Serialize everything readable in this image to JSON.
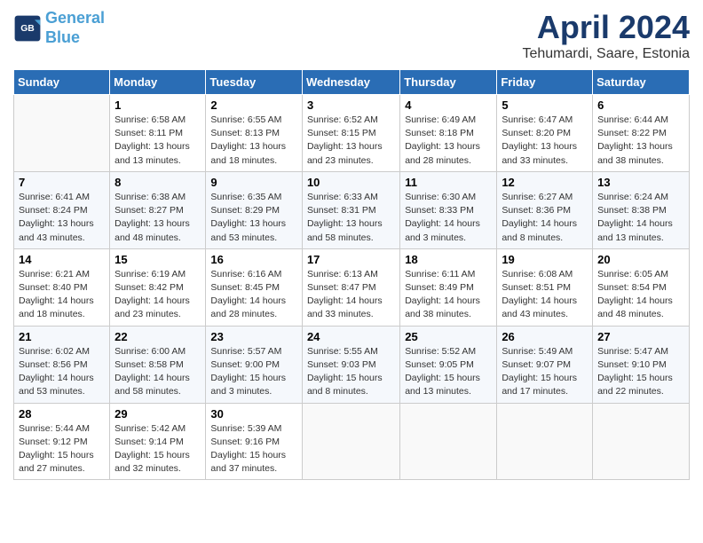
{
  "header": {
    "logo_line1": "General",
    "logo_line2": "Blue",
    "month_title": "April 2024",
    "location": "Tehumardi, Saare, Estonia"
  },
  "weekdays": [
    "Sunday",
    "Monday",
    "Tuesday",
    "Wednesday",
    "Thursday",
    "Friday",
    "Saturday"
  ],
  "weeks": [
    [
      {
        "day": "",
        "info": ""
      },
      {
        "day": "1",
        "info": "Sunrise: 6:58 AM\nSunset: 8:11 PM\nDaylight: 13 hours\nand 13 minutes."
      },
      {
        "day": "2",
        "info": "Sunrise: 6:55 AM\nSunset: 8:13 PM\nDaylight: 13 hours\nand 18 minutes."
      },
      {
        "day": "3",
        "info": "Sunrise: 6:52 AM\nSunset: 8:15 PM\nDaylight: 13 hours\nand 23 minutes."
      },
      {
        "day": "4",
        "info": "Sunrise: 6:49 AM\nSunset: 8:18 PM\nDaylight: 13 hours\nand 28 minutes."
      },
      {
        "day": "5",
        "info": "Sunrise: 6:47 AM\nSunset: 8:20 PM\nDaylight: 13 hours\nand 33 minutes."
      },
      {
        "day": "6",
        "info": "Sunrise: 6:44 AM\nSunset: 8:22 PM\nDaylight: 13 hours\nand 38 minutes."
      }
    ],
    [
      {
        "day": "7",
        "info": "Sunrise: 6:41 AM\nSunset: 8:24 PM\nDaylight: 13 hours\nand 43 minutes."
      },
      {
        "day": "8",
        "info": "Sunrise: 6:38 AM\nSunset: 8:27 PM\nDaylight: 13 hours\nand 48 minutes."
      },
      {
        "day": "9",
        "info": "Sunrise: 6:35 AM\nSunset: 8:29 PM\nDaylight: 13 hours\nand 53 minutes."
      },
      {
        "day": "10",
        "info": "Sunrise: 6:33 AM\nSunset: 8:31 PM\nDaylight: 13 hours\nand 58 minutes."
      },
      {
        "day": "11",
        "info": "Sunrise: 6:30 AM\nSunset: 8:33 PM\nDaylight: 14 hours\nand 3 minutes."
      },
      {
        "day": "12",
        "info": "Sunrise: 6:27 AM\nSunset: 8:36 PM\nDaylight: 14 hours\nand 8 minutes."
      },
      {
        "day": "13",
        "info": "Sunrise: 6:24 AM\nSunset: 8:38 PM\nDaylight: 14 hours\nand 13 minutes."
      }
    ],
    [
      {
        "day": "14",
        "info": "Sunrise: 6:21 AM\nSunset: 8:40 PM\nDaylight: 14 hours\nand 18 minutes."
      },
      {
        "day": "15",
        "info": "Sunrise: 6:19 AM\nSunset: 8:42 PM\nDaylight: 14 hours\nand 23 minutes."
      },
      {
        "day": "16",
        "info": "Sunrise: 6:16 AM\nSunset: 8:45 PM\nDaylight: 14 hours\nand 28 minutes."
      },
      {
        "day": "17",
        "info": "Sunrise: 6:13 AM\nSunset: 8:47 PM\nDaylight: 14 hours\nand 33 minutes."
      },
      {
        "day": "18",
        "info": "Sunrise: 6:11 AM\nSunset: 8:49 PM\nDaylight: 14 hours\nand 38 minutes."
      },
      {
        "day": "19",
        "info": "Sunrise: 6:08 AM\nSunset: 8:51 PM\nDaylight: 14 hours\nand 43 minutes."
      },
      {
        "day": "20",
        "info": "Sunrise: 6:05 AM\nSunset: 8:54 PM\nDaylight: 14 hours\nand 48 minutes."
      }
    ],
    [
      {
        "day": "21",
        "info": "Sunrise: 6:02 AM\nSunset: 8:56 PM\nDaylight: 14 hours\nand 53 minutes."
      },
      {
        "day": "22",
        "info": "Sunrise: 6:00 AM\nSunset: 8:58 PM\nDaylight: 14 hours\nand 58 minutes."
      },
      {
        "day": "23",
        "info": "Sunrise: 5:57 AM\nSunset: 9:00 PM\nDaylight: 15 hours\nand 3 minutes."
      },
      {
        "day": "24",
        "info": "Sunrise: 5:55 AM\nSunset: 9:03 PM\nDaylight: 15 hours\nand 8 minutes."
      },
      {
        "day": "25",
        "info": "Sunrise: 5:52 AM\nSunset: 9:05 PM\nDaylight: 15 hours\nand 13 minutes."
      },
      {
        "day": "26",
        "info": "Sunrise: 5:49 AM\nSunset: 9:07 PM\nDaylight: 15 hours\nand 17 minutes."
      },
      {
        "day": "27",
        "info": "Sunrise: 5:47 AM\nSunset: 9:10 PM\nDaylight: 15 hours\nand 22 minutes."
      }
    ],
    [
      {
        "day": "28",
        "info": "Sunrise: 5:44 AM\nSunset: 9:12 PM\nDaylight: 15 hours\nand 27 minutes."
      },
      {
        "day": "29",
        "info": "Sunrise: 5:42 AM\nSunset: 9:14 PM\nDaylight: 15 hours\nand 32 minutes."
      },
      {
        "day": "30",
        "info": "Sunrise: 5:39 AM\nSunset: 9:16 PM\nDaylight: 15 hours\nand 37 minutes."
      },
      {
        "day": "",
        "info": ""
      },
      {
        "day": "",
        "info": ""
      },
      {
        "day": "",
        "info": ""
      },
      {
        "day": "",
        "info": ""
      }
    ]
  ]
}
